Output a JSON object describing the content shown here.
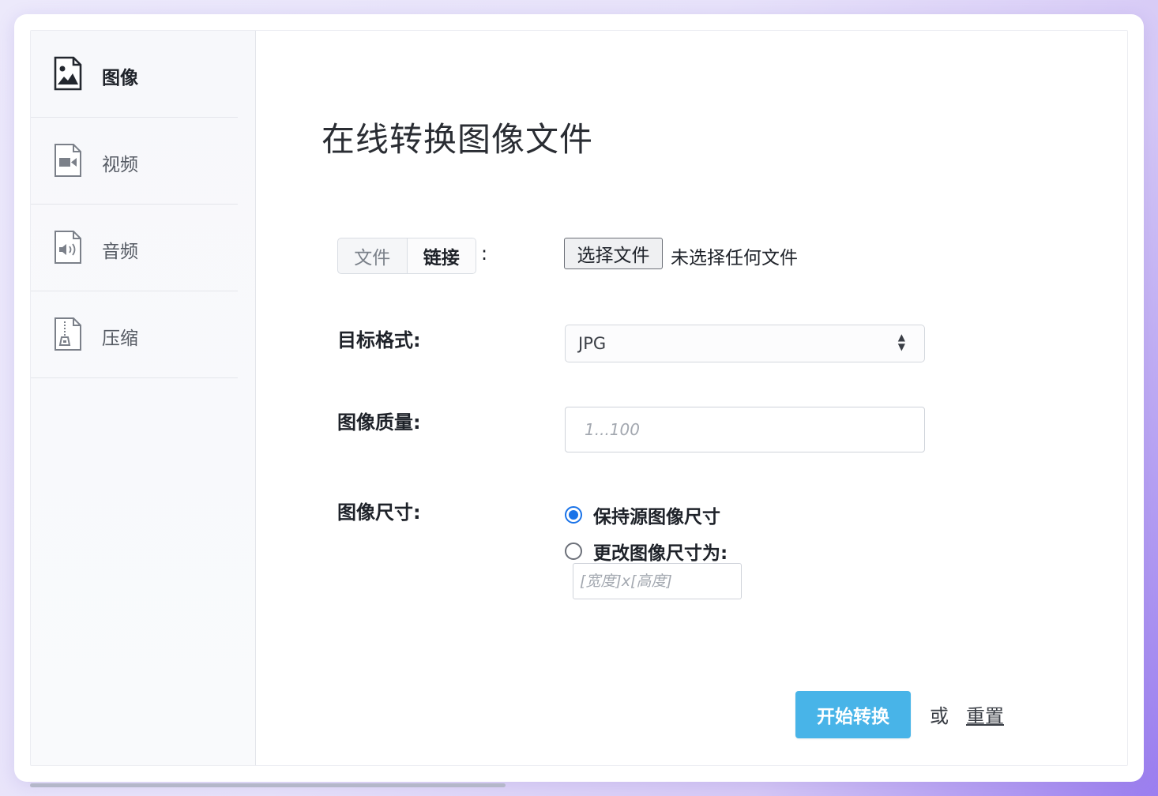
{
  "sidebar": {
    "items": [
      {
        "label": "图像",
        "icon": "image-file-icon",
        "active": true
      },
      {
        "label": "视频",
        "icon": "video-file-icon",
        "active": false
      },
      {
        "label": "音频",
        "icon": "audio-file-icon",
        "active": false
      },
      {
        "label": "压缩",
        "icon": "archive-file-icon",
        "active": false
      }
    ]
  },
  "main": {
    "title": "在线转换图像文件",
    "source": {
      "tabs": [
        "文件",
        "链接"
      ],
      "active_tab": "链接",
      "colon": ":",
      "choose_button": "选择文件",
      "file_status": "未选择任何文件"
    },
    "target_format": {
      "label": "目标格式:",
      "value": "JPG"
    },
    "quality": {
      "label": "图像质量:",
      "placeholder": "1...100"
    },
    "size": {
      "label": "图像尺寸:",
      "options": [
        "保持源图像尺寸",
        "更改图像尺寸为:"
      ],
      "selected_index": 0,
      "placeholder": "[宽度]x[高度]"
    },
    "actions": {
      "convert_label": "开始转换",
      "or_text": "或",
      "reset_label": "重置"
    }
  },
  "colors": {
    "accent": "#48b4e8",
    "radio_checked": "#1a73e8"
  }
}
